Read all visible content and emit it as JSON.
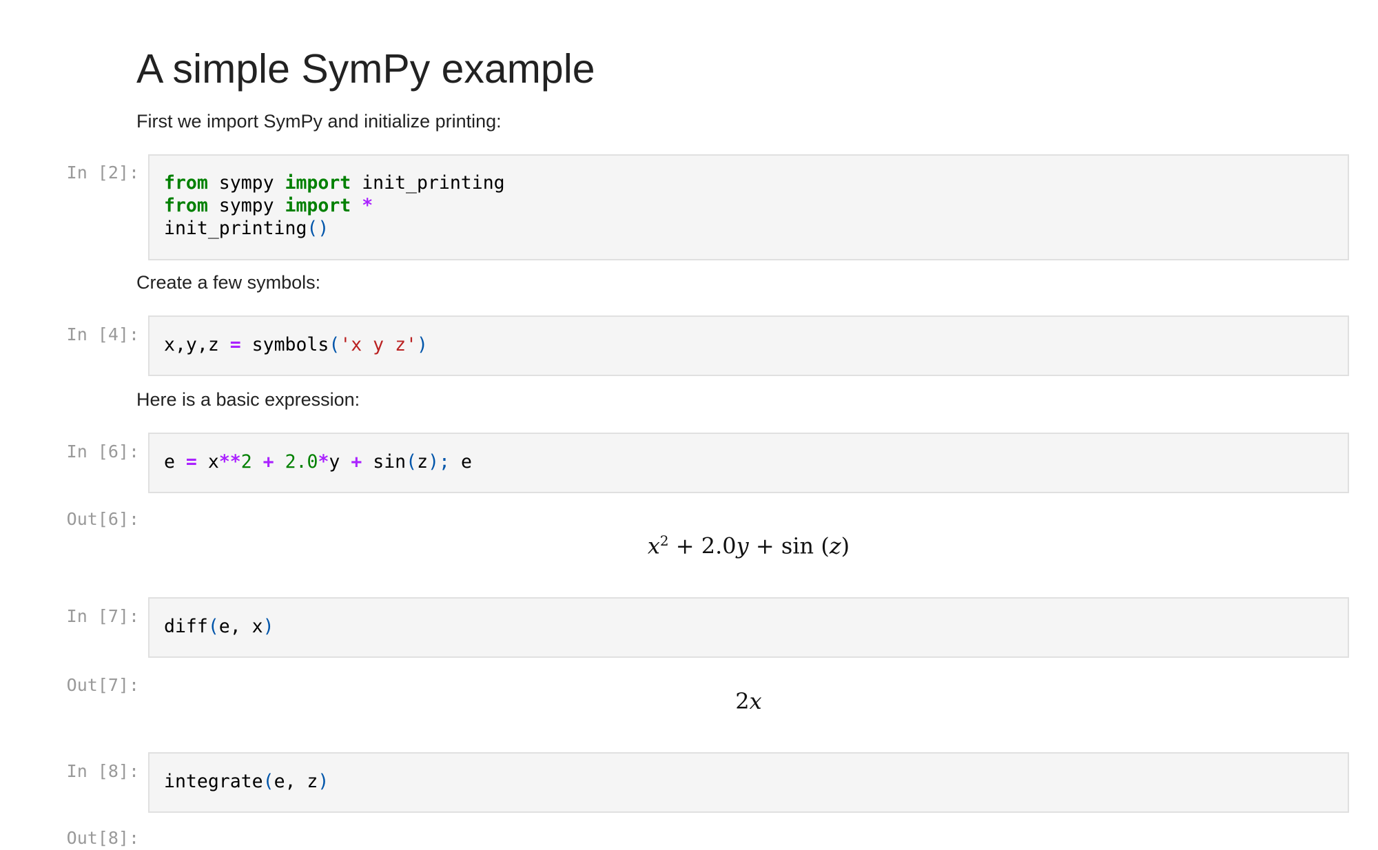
{
  "heading": "A simple SymPy example",
  "paragraphs": {
    "intro": "First we import SymPy and initialize printing:",
    "symbols": "Create a few symbols:",
    "expr": "Here is a basic expression:"
  },
  "cells": {
    "c2": {
      "prompt": "In [2]:"
    },
    "c4": {
      "prompt": "In [4]:"
    },
    "c6": {
      "prompt": "In [6]:",
      "out_prompt": "Out[6]:"
    },
    "c7": {
      "prompt": "In [7]:",
      "out_prompt": "Out[7]:"
    },
    "c8": {
      "prompt": "In [8]:",
      "out_prompt": "Out[8]:"
    }
  },
  "code": {
    "c2": {
      "l1": {
        "kw1": "from",
        "mod": " sympy ",
        "kw2": "import",
        "name": " init_printing"
      },
      "l2": {
        "kw1": "from",
        "mod": " sympy ",
        "kw2": "import",
        "star": " *"
      },
      "l3": {
        "fn": "init_printing",
        "paren": "()"
      }
    },
    "c4": {
      "lhs": "x,y,z ",
      "eq": "=",
      "fn": " symbols",
      "open": "(",
      "str": "'x y z'",
      "close": ")"
    },
    "c6": {
      "e": "e ",
      "eq": "=",
      "x": " x",
      "pow": "**",
      "two": "2 ",
      "plus1": "+",
      "coef": " 2.0",
      "mul": "*",
      "y": "y ",
      "plus2": "+",
      "sin": " sin",
      "open": "(",
      "z": "z",
      "close": ")",
      "semi": ";",
      "tail": " e"
    },
    "c7": {
      "fn": "diff",
      "open": "(",
      "args": "e, x",
      "close": ")"
    },
    "c8": {
      "fn": "integrate",
      "open": "(",
      "args": "e, z",
      "close": ")"
    }
  },
  "outputs": {
    "out6": {
      "x": "x",
      "exp": "2",
      "rest1": " + 2.0",
      "y": "y",
      "rest2": " + sin (",
      "z": "z",
      "rest3": ")"
    },
    "out7": {
      "coef": "2",
      "x": "x"
    }
  }
}
